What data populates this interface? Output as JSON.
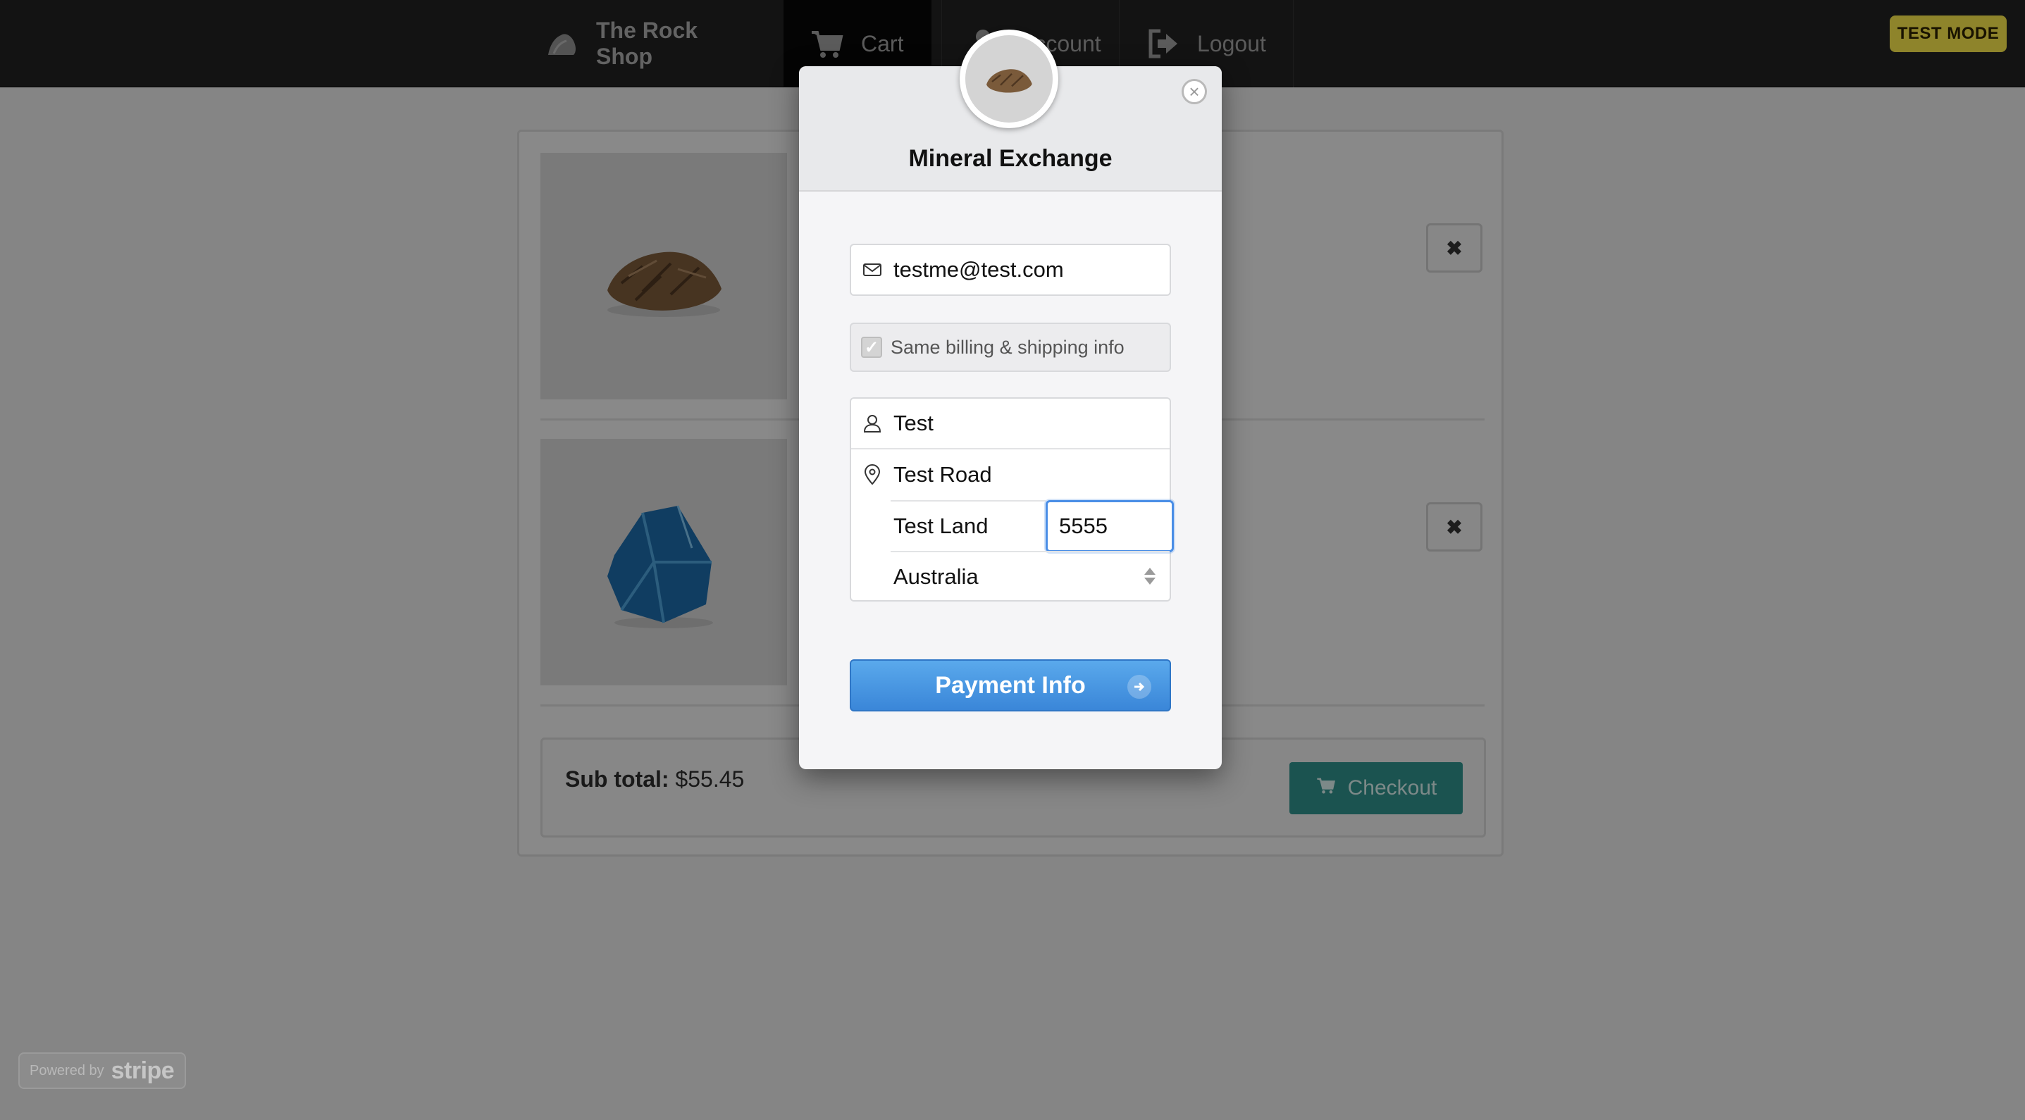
{
  "navbar": {
    "brand_label": "The Rock Shop",
    "cart_label": "Cart",
    "account_label": "Account",
    "logout_label": "Logout"
  },
  "test_mode_badge": "TEST MODE",
  "cart": {
    "items": [
      {
        "image_icon": "rock-photo-icon"
      },
      {
        "image_icon": "blue-crystal-photo-icon"
      }
    ],
    "remove_icon": "close-x-icon",
    "subtotal_label": "Sub total:",
    "subtotal_value": "$55.45",
    "checkout_label": "Checkout"
  },
  "checkout_modal": {
    "merchant_name": "Mineral Exchange",
    "email_value": "testme@test.com",
    "same_billing_label": "Same billing & shipping info",
    "same_billing_checked": true,
    "name_value": "Test",
    "street_value": "Test Road",
    "city_value": "Test Land",
    "zip_value": "5555",
    "country_value": "Australia",
    "pay_button_label": "Payment Info"
  },
  "footer": {
    "powered_by_label": "Powered by",
    "stripe_label": "stripe"
  },
  "colors": {
    "navbar_bg": "#222222",
    "test_mode_bg": "#f4e34a",
    "checkout_bg": "#2f8f8a",
    "pay_button_bg": "#3a86d8",
    "focus_ring": "#4a8ee6"
  }
}
